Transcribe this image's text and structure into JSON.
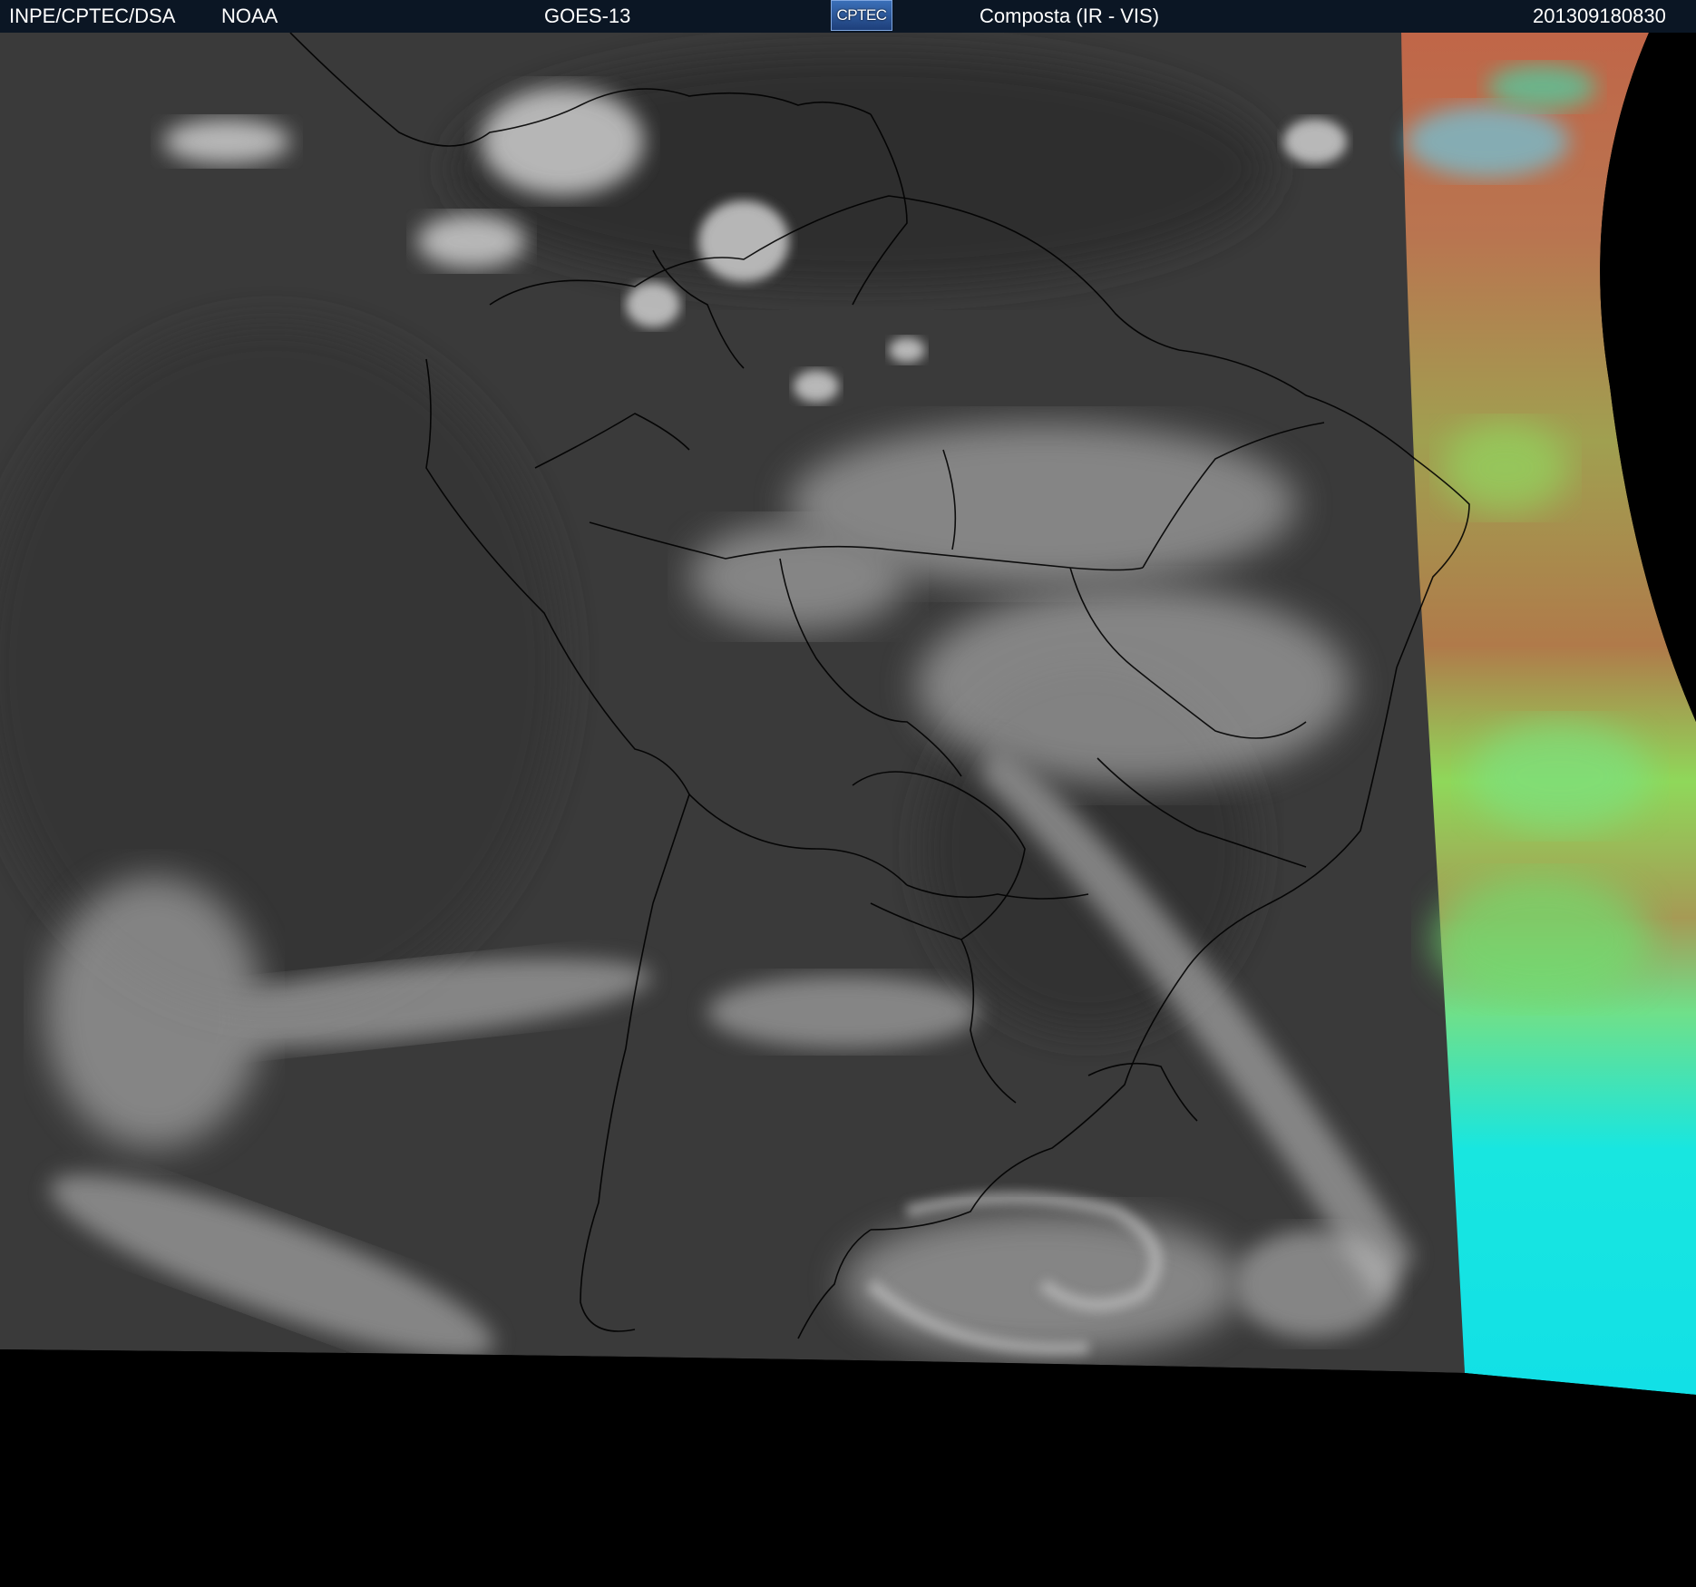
{
  "header": {
    "institution": "INPE/CPTEC/DSA",
    "agency": "NOAA",
    "satellite": "GOES-13",
    "logo_text": "CPTEC",
    "product": "Composta (IR - VIS)",
    "timestamp": "201309180830"
  },
  "colors": {
    "header_bg": "#0b1624",
    "header_text": "#ffffff",
    "ir_background": "#3a3a3a",
    "cloud": "#d8d8d8",
    "vis_warm": "#b36a48",
    "vis_green": "#8fd85a",
    "vis_cyan": "#18e6e0",
    "space": "#000000",
    "borders": "#000000"
  },
  "icons": {
    "logo": "cptec-logo"
  }
}
